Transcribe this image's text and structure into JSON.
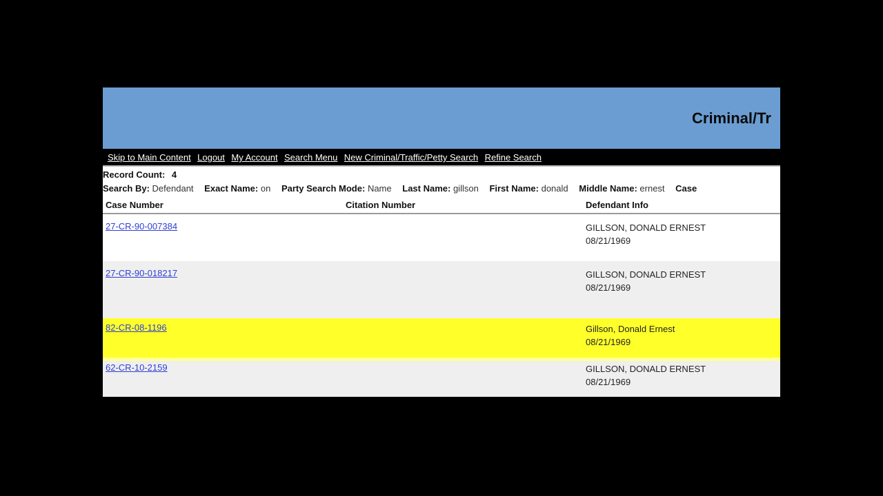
{
  "banner": {
    "title": "Criminal/Tr",
    "color": "#6b9dd3"
  },
  "nav": {
    "links": [
      "Skip to Main Content",
      "Logout",
      "My Account",
      "Search Menu",
      "New Criminal/Traffic/Petty Search",
      "Refine Search"
    ]
  },
  "record_count": {
    "label": "Record Count:",
    "value": "4"
  },
  "criteria": [
    {
      "label": "Search By:",
      "value": "Defendant"
    },
    {
      "label": "Exact Name:",
      "value": "on"
    },
    {
      "label": "Party Search Mode:",
      "value": "Name"
    },
    {
      "label": "Last Name:",
      "value": "gillson"
    },
    {
      "label": "First Name:",
      "value": "donald"
    },
    {
      "label": "Middle Name:",
      "value": "ernest"
    },
    {
      "label": "Case",
      "value": ""
    }
  ],
  "table": {
    "headers": {
      "case": "Case Number",
      "citation": "Citation Number",
      "defendant": "Defendant Info"
    },
    "rows": [
      {
        "case": "27-CR-90-007384",
        "citation": "",
        "name": "GILLSON, DONALD ERNEST",
        "dob": "08/21/1969"
      },
      {
        "case": "27-CR-90-018217",
        "citation": "",
        "name": "GILLSON, DONALD ERNEST",
        "dob": "08/21/1969"
      },
      {
        "case": "82-CR-08-1196",
        "citation": "",
        "name": "Gillson, Donald Ernest",
        "dob": "08/21/1969"
      },
      {
        "case": "62-CR-10-2159",
        "citation": "",
        "name": "GILLSON, DONALD ERNEST",
        "dob": "08/21/1969"
      }
    ]
  },
  "colors": {
    "highlight": "#ffff2a",
    "link": "#2d3fd6",
    "alt_row": "#efefef"
  }
}
